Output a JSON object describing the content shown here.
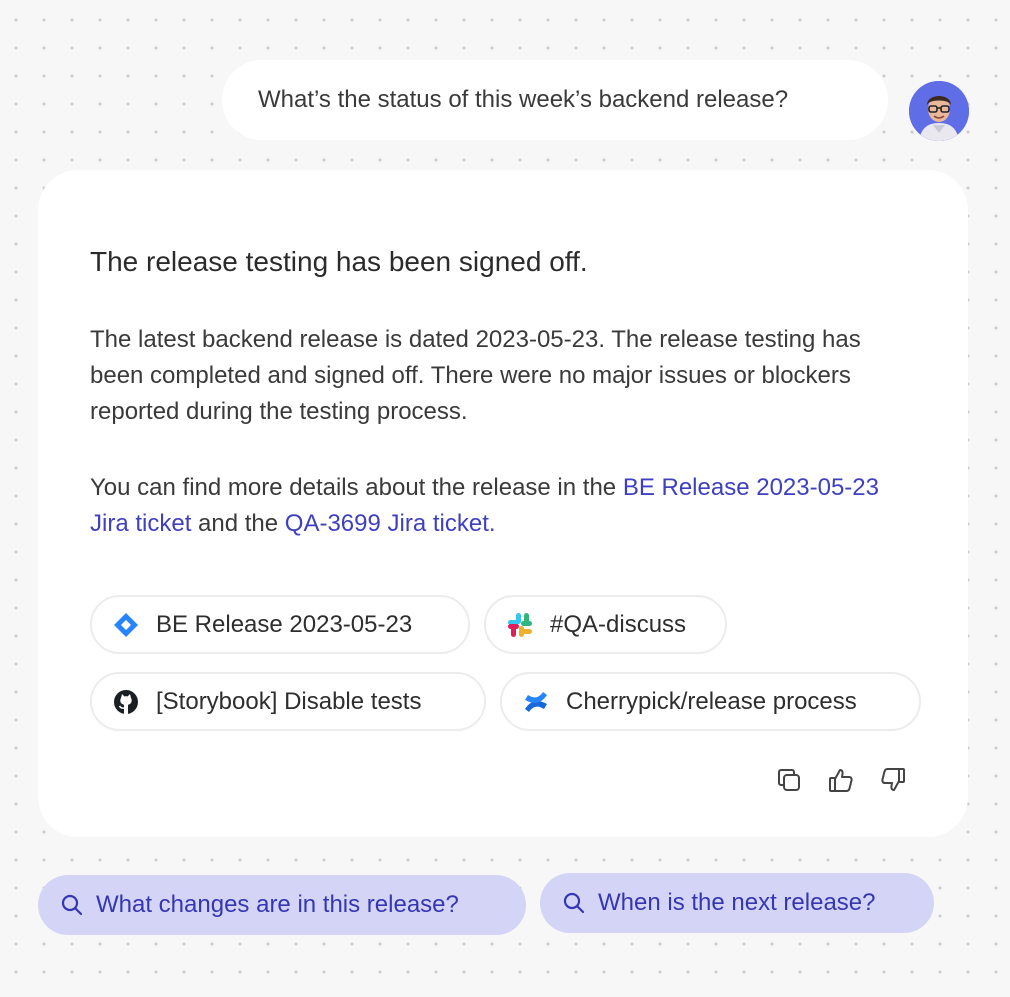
{
  "user_message": "What’s the status of this week’s backend release?",
  "response": {
    "title": "The release testing has been signed off.",
    "paragraph1": "The latest backend release is dated 2023-05-23. The release testing has been completed and signed off. There were no major issues or blockers reported during the testing process.",
    "paragraph2_prefix": "You can find more details about the release in the ",
    "link1": "BE Release 2023-05-23 Jira ticket",
    "paragraph2_middle": " and the ",
    "link2": "QA-3699 Jira ticket."
  },
  "sources": [
    {
      "label": "BE Release 2023-05-23",
      "icon": "jira-icon"
    },
    {
      "label": "#QA-discuss",
      "icon": "slack-icon"
    },
    {
      "label": "[Storybook] Disable tests",
      "icon": "github-icon"
    },
    {
      "label": "Cherrypick/release process",
      "icon": "confluence-icon"
    }
  ],
  "actions": [
    {
      "name": "copy-icon"
    },
    {
      "name": "thumbs-up-icon"
    },
    {
      "name": "thumbs-down-icon"
    }
  ],
  "suggestions": [
    "What changes are in this release?",
    "When is the next release?"
  ],
  "colors": {
    "link": "#3f3fc2",
    "suggestion_bg": "#d4d5f6",
    "suggestion_text": "#3636b4",
    "avatar_bg": "#5f6ee6",
    "jira": "#2684ff",
    "confluence": "#1868db"
  }
}
